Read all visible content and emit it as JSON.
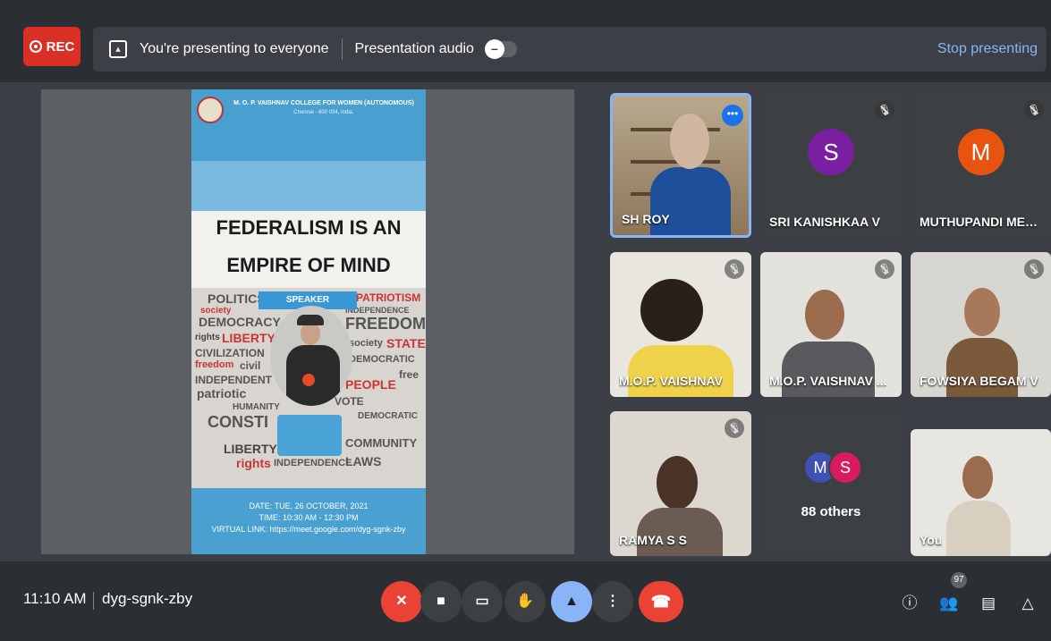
{
  "top_bar": {
    "rec_label": "REC",
    "presenting_text": "You're presenting to everyone",
    "audio_label": "Presentation audio",
    "stop_label": "Stop presenting"
  },
  "poster": {
    "college": "M. O. P. VAISHNAV COLLEGE FOR WOMEN (AUTONOMOUS)",
    "city": "Chennai - 600 034, India.",
    "title_line1": "FEDERALISM IS AN",
    "title_line2": "EMPIRE OF MIND",
    "speaker_tag": "SPEAKER",
    "date": "DATE: TUE, 26 OCTOBER, 2021",
    "time": "TIME: 10:30 AM - 12:30 PM",
    "link": "VIRTUAL LINK: https://meet.google.com/dyg-sgnk-zby",
    "cloud_words": [
      "POLITICS",
      "society",
      "DEMOCRACY",
      "rights",
      "LIBERTY",
      "CIVILIZATION",
      "freedom",
      "civil",
      "INDEPENDENT",
      "patriotic",
      "HUMANITY",
      "CONSTI",
      "LIBERTY!",
      "rights",
      "INDEPENDENCE",
      "PATRIOTISM",
      "INDEPENDENCE",
      "FREEDOM",
      "society",
      "STATE",
      "DEMOCRATIC",
      "PEOPLE",
      "free",
      "VOTE",
      "DEMOCRATIC",
      "COMMUNITY",
      "LAWS"
    ]
  },
  "participants": [
    {
      "name": "SH ROY",
      "type": "video"
    },
    {
      "name": "SRI KANISHKAA V",
      "initial": "S",
      "color": "#7b1fa2"
    },
    {
      "name": "MUTHUPANDI MEEN...",
      "initial": "M",
      "color": "#e8540f"
    },
    {
      "name": "M.O.P. VAISHNAV",
      "type": "video"
    },
    {
      "name": "M.O.P. VAISHNAV ...",
      "type": "video"
    },
    {
      "name": "FOWSIYA BEGAM V",
      "type": "video"
    },
    {
      "name": "RAMYA S S",
      "type": "video"
    },
    {
      "name": "88 others",
      "avatars": [
        "M",
        "S"
      ]
    },
    {
      "name": "You",
      "type": "video"
    }
  ],
  "bottom_bar": {
    "time": "11:10 AM",
    "meeting_code": "dyg-sgnk-zby",
    "people_count": "97"
  },
  "colors": {
    "accent_blue": "#8ab4f8",
    "record_red": "#d93025",
    "end_call_red": "#ea4335"
  }
}
